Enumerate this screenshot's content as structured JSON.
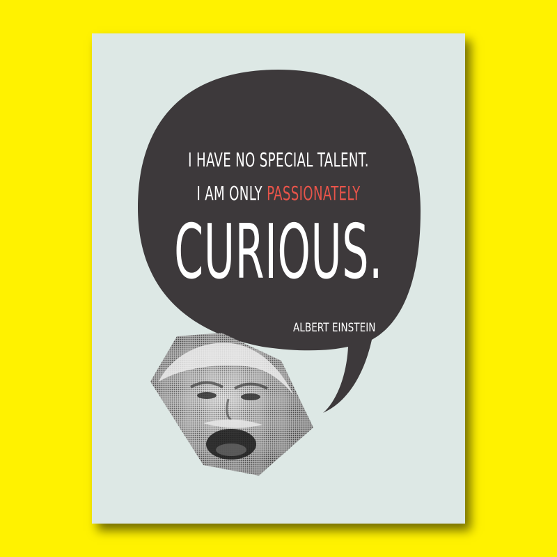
{
  "colors": {
    "background": "#fff200",
    "poster": "#dde8e5",
    "bubble": "#3d393b",
    "text": "#ffffff",
    "accent": "#e8544a"
  },
  "quote": {
    "line1": "I HAVE NO SPECIAL TALENT.",
    "line2_prefix": "I AM ONLY",
    "line2_accent": "PASSIONATELY",
    "line3": "CURIOUS."
  },
  "author": "ALBERT EINSTEIN",
  "portrait": {
    "icon": "halftone-portrait-photo"
  }
}
